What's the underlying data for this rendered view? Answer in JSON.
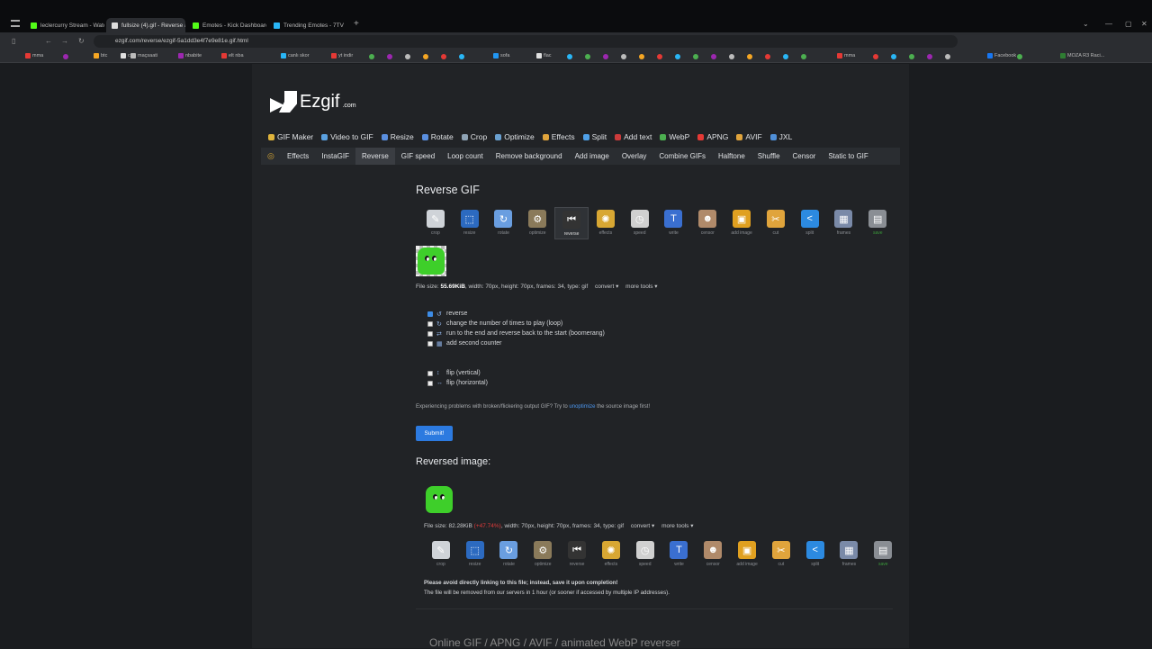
{
  "browser": {
    "tabs": [
      {
        "label": "leclercurry Stream - Watch",
        "color": "#53fc18"
      },
      {
        "label": "fullsize (4).gif - Reverse ani",
        "color": "#dddddd"
      },
      {
        "label": "Emotes - Kick Dashboard",
        "color": "#53fc18"
      },
      {
        "label": "Trending Emotes - 7TV",
        "color": "#29b6f6"
      }
    ],
    "url": "ezgif.com/reverse/ezgif-5a1dd3e4f7e9e81e.gif.html",
    "bookmarks": [
      "mma",
      "btc",
      "cs",
      "maçsaati",
      "nbabite",
      "elt nba",
      "canlı skor",
      "yt indir",
      "sofa",
      "flac",
      "mma",
      "Facebook",
      "MOZA R3 Raci..."
    ]
  },
  "site": {
    "logo_name": "Ezgif",
    "logo_suffix": ".com",
    "main_nav": [
      {
        "label": "GIF Maker",
        "color": "#e0b43c"
      },
      {
        "label": "Video to GIF",
        "color": "#5aa0e0"
      },
      {
        "label": "Resize",
        "color": "#5a8fe0"
      },
      {
        "label": "Rotate",
        "color": "#5a8fe0"
      },
      {
        "label": "Crop",
        "color": "#8fa3b5"
      },
      {
        "label": "Optimize",
        "color": "#6aa0d0"
      },
      {
        "label": "Effects",
        "color": "#e0a43c"
      },
      {
        "label": "Split",
        "color": "#4fa0e8"
      },
      {
        "label": "Add text",
        "color": "#cc3b3b"
      },
      {
        "label": "WebP",
        "color": "#4caf50"
      },
      {
        "label": "APNG",
        "color": "#e53935"
      },
      {
        "label": "AVIF",
        "color": "#e0a43c"
      },
      {
        "label": "JXL",
        "color": "#4f8fd8"
      }
    ],
    "sub_nav": [
      "Effects",
      "InstaGIF",
      "Reverse",
      "GIF speed",
      "Loop count",
      "Remove background",
      "Add image",
      "Overlay",
      "Combine GIFs",
      "Halftone",
      "Shuffle",
      "Censor",
      "Static to GIF"
    ],
    "sub_nav_active": "Reverse"
  },
  "main": {
    "title": "Reverse GIF",
    "toolbar": [
      {
        "label": "crop",
        "icon": "crop-icon",
        "glyph": "✎",
        "bg": "#cfd3d8"
      },
      {
        "label": "resize",
        "icon": "resize-icon",
        "glyph": "⬚",
        "bg": "#2c6ac0"
      },
      {
        "label": "rotate",
        "icon": "rotate-icon",
        "glyph": "↻",
        "bg": "#6a9ee0"
      },
      {
        "label": "optimize",
        "icon": "optimize-icon",
        "glyph": "⚙",
        "bg": "#8a7a5a"
      },
      {
        "label": "reverse",
        "icon": "reverse-icon",
        "glyph": "⏮",
        "bg": "#333333"
      },
      {
        "label": "effects",
        "icon": "effects-icon",
        "glyph": "✺",
        "bg": "#d8a733"
      },
      {
        "label": "speed",
        "icon": "speed-icon",
        "glyph": "◷",
        "bg": "#d0d0d0"
      },
      {
        "label": "write",
        "icon": "write-icon",
        "glyph": "T",
        "bg": "#3a6fd0"
      },
      {
        "label": "censor",
        "icon": "censor-icon",
        "glyph": "☻",
        "bg": "#b08a6a"
      },
      {
        "label": "add image",
        "icon": "add-image-icon",
        "glyph": "▣",
        "bg": "#e0a020"
      },
      {
        "label": "cut",
        "icon": "cut-icon",
        "glyph": "✂",
        "bg": "#e0a43c"
      },
      {
        "label": "split",
        "icon": "split-icon",
        "glyph": "<",
        "bg": "#2c8ae0"
      },
      {
        "label": "frames",
        "icon": "frames-icon",
        "glyph": "▦",
        "bg": "#7a8aa8"
      },
      {
        "label": "save",
        "icon": "save-icon",
        "glyph": "▤",
        "bg": "#8a8e94"
      }
    ],
    "selected_tool": "reverse",
    "file_info_prefix": "File size: ",
    "file_size": "55.69KiB",
    "file_info_rest": ", width: 70px, height: 70px, frames: 34, type: gif",
    "convert_label": "convert ▾",
    "more_tools_label": "more tools ▾",
    "options": [
      {
        "label": "reverse",
        "checked": true,
        "icon": "↺"
      },
      {
        "label": "change the number of times to play (loop)",
        "checked": false,
        "icon": "↻"
      },
      {
        "label": "run to the end and reverse back to the start (boomerang)",
        "checked": false,
        "icon": "⇄"
      },
      {
        "label": "add second counter",
        "checked": false,
        "icon": "▦"
      }
    ],
    "flip_options": [
      {
        "label": "flip (vertical)",
        "checked": false,
        "icon": "↕"
      },
      {
        "label": "flip (horizontal)",
        "checked": false,
        "icon": "↔"
      }
    ],
    "note_prefix": "Experiencing problems with broken/flickering output GIF? Try to ",
    "note_link": "unoptimize",
    "note_suffix": " the source image first!",
    "submit_label": "Submit!"
  },
  "result": {
    "title": "Reversed image:",
    "file_info_prefix": "File size: ",
    "file_size": "82.28KiB",
    "size_change": "(+47.74%)",
    "file_info_rest": ", width: 70px, height: 70px, frames: 34, type: gif",
    "warning_1": "Please avoid directly linking to this file; instead, save it upon completion!",
    "warning_2": "The file will be removed from our servers in 1 hour (or sooner if accessed by multiple IP addresses).",
    "bottom_heading": "Online GIF / APNG / AVIF / animated WebP reverser"
  }
}
